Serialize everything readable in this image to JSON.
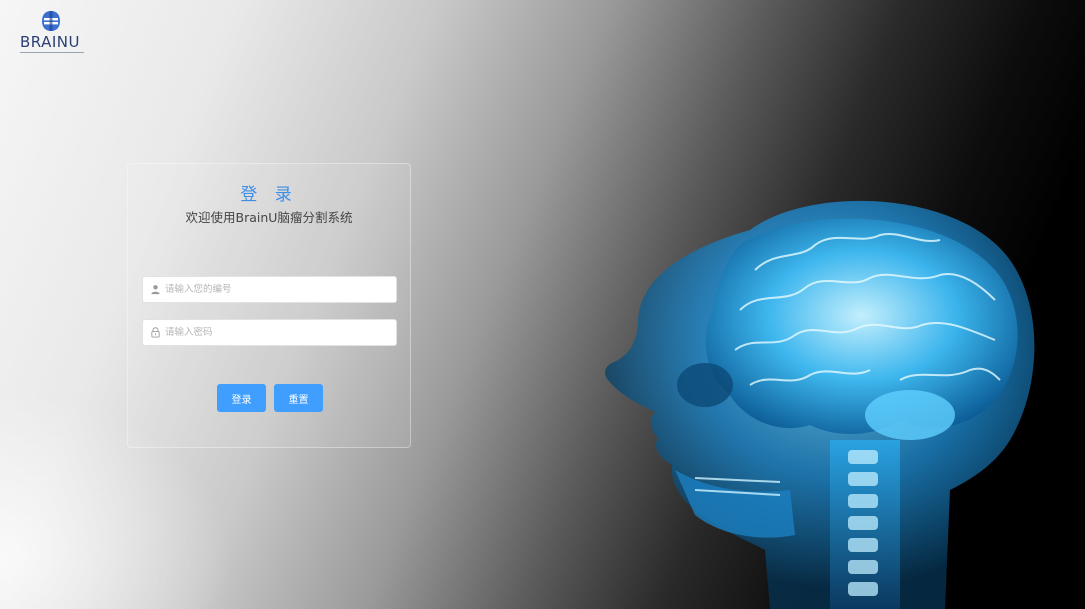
{
  "logo": {
    "text": "BRAINU",
    "icon": "brainu-logo-icon"
  },
  "login": {
    "title": "登 录",
    "subtitle": "欢迎使用BrainU脑瘤分割系统",
    "id_field": {
      "placeholder": "请输入您的编号",
      "value": "",
      "icon": "user-icon"
    },
    "password_field": {
      "placeholder": "请输入密码",
      "value": "",
      "icon": "lock-icon"
    },
    "login_button": "登录",
    "reset_button": "重置"
  },
  "colors": {
    "accent": "#409eff",
    "title": "#3e8ee8",
    "logo": "#2a3f73",
    "xray": "#2fb7ff"
  },
  "hero": {
    "icon": "xray-head-illustration"
  }
}
